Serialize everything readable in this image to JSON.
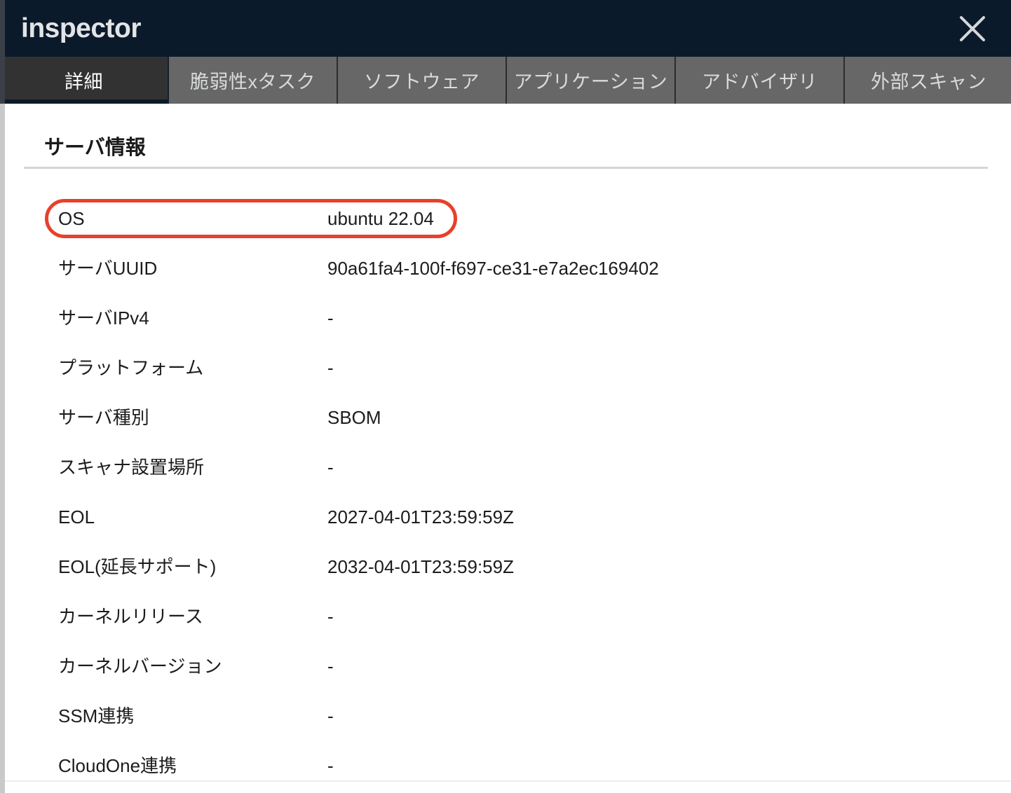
{
  "window": {
    "title": "inspector",
    "close_icon": "close-icon"
  },
  "tabs": [
    {
      "label": "詳細",
      "active": true
    },
    {
      "label": "脆弱性xタスク",
      "active": false
    },
    {
      "label": "ソフトウェア",
      "active": false
    },
    {
      "label": "アプリケーション",
      "active": false
    },
    {
      "label": "アドバイザリ",
      "active": false
    },
    {
      "label": "外部スキャン",
      "active": false
    }
  ],
  "section": {
    "title": "サーバ情報"
  },
  "rows": [
    {
      "label": "OS",
      "value": "ubuntu 22.04",
      "highlighted": true
    },
    {
      "label": "サーバUUID",
      "value": "90a61fa4-100f-f697-ce31-e7a2ec169402",
      "highlighted": false
    },
    {
      "label": "サーバIPv4",
      "value": "-",
      "highlighted": false
    },
    {
      "label": "プラットフォーム",
      "value": "-",
      "highlighted": false
    },
    {
      "label": "サーバ種別",
      "value": "SBOM",
      "highlighted": false
    },
    {
      "label": "スキャナ設置場所",
      "value": "-",
      "highlighted": false
    },
    {
      "label": "EOL",
      "value": "2027-04-01T23:59:59Z",
      "highlighted": false
    },
    {
      "label": "EOL(延長サポート)",
      "value": "2032-04-01T23:59:59Z",
      "highlighted": false
    },
    {
      "label": "カーネルリリース",
      "value": "-",
      "highlighted": false
    },
    {
      "label": "カーネルバージョン",
      "value": "-",
      "highlighted": false
    },
    {
      "label": "SSM連携",
      "value": "-",
      "highlighted": false
    },
    {
      "label": "CloudOne連携",
      "value": "-",
      "highlighted": false
    }
  ],
  "colors": {
    "header_bg": "#0b1a2b",
    "tab_inactive_bg": "#676767",
    "tab_active_bg": "#323232",
    "annotation_stroke": "#e8402a",
    "text_primary": "#1c1c1c",
    "rule": "#d5d5d5"
  }
}
